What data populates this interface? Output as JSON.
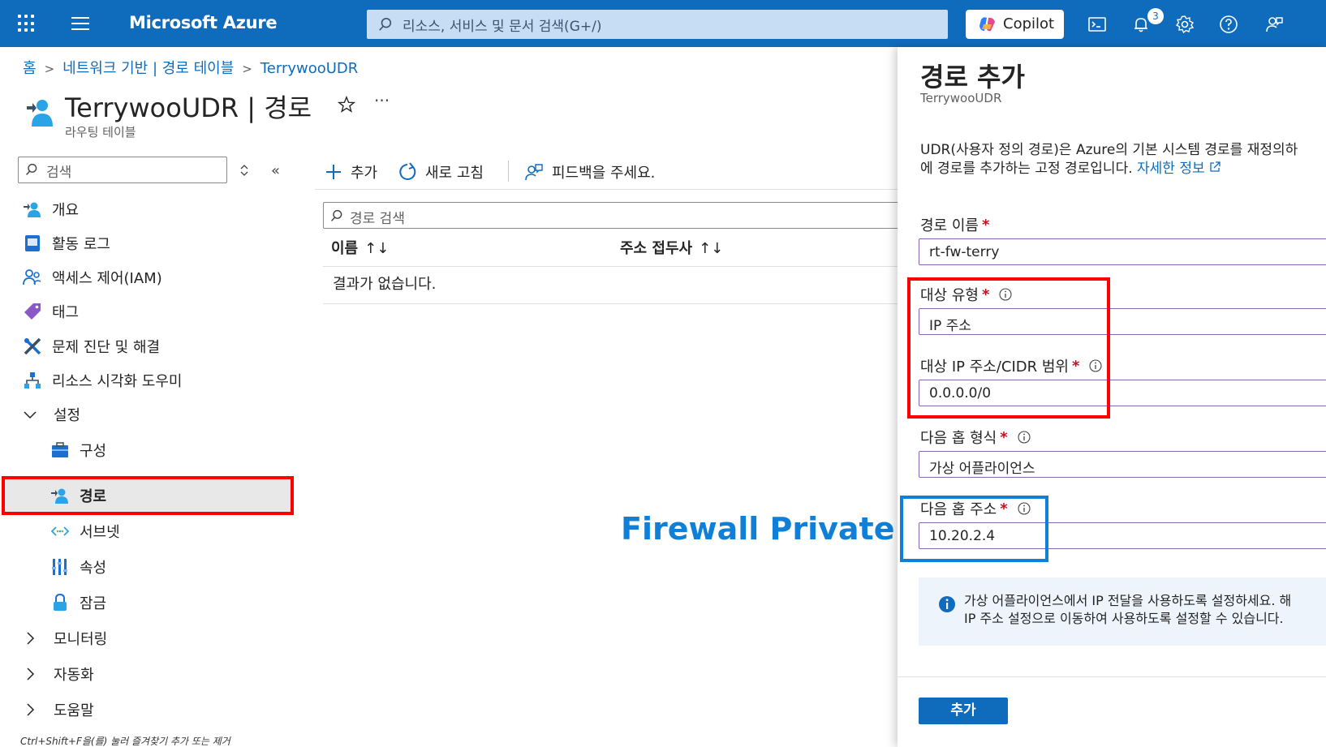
{
  "topbar": {
    "brand": "Microsoft Azure",
    "search_placeholder": "리소스, 서비스 및 문서 검색(G+/)",
    "copilot_label": "Copilot",
    "notification_count": "3"
  },
  "breadcrumb": {
    "items": [
      "홈",
      "네트워크 기반 | 경로 테이블",
      "TerrywooUDR"
    ]
  },
  "header": {
    "title": "TerrywooUDR | 경로",
    "subtitle": "라우팅 테이블",
    "more": "···"
  },
  "nav": {
    "search_placeholder": "검색",
    "collapse": "«",
    "items": [
      {
        "label": "개요",
        "icon": "overview-icon"
      },
      {
        "label": "활동 로그",
        "icon": "activity-log-icon"
      },
      {
        "label": "액세스 제어(IAM)",
        "icon": "iam-icon"
      },
      {
        "label": "태그",
        "icon": "tag-icon"
      },
      {
        "label": "문제 진단 및 해결",
        "icon": "diagnose-icon"
      },
      {
        "label": "리소스 시각화 도우미",
        "icon": "visualizer-icon"
      }
    ],
    "settings_group": "설정",
    "settings_items": [
      {
        "label": "구성",
        "icon": "configuration-icon"
      },
      {
        "label": "경로",
        "icon": "routes-icon"
      },
      {
        "label": "서브넷",
        "icon": "subnet-icon"
      },
      {
        "label": "속성",
        "icon": "properties-icon"
      },
      {
        "label": "잠금",
        "icon": "lock-icon"
      }
    ],
    "collapsed_groups": [
      "모니터링",
      "자동화",
      "도움말"
    ],
    "footer_hint": "Ctrl+Shift+F을(를) 눌러 즐겨찾기 추가 또는 제거"
  },
  "commands": {
    "add": "추가",
    "refresh": "새로 고침",
    "feedback": "피드백을 주세요."
  },
  "grid": {
    "search_placeholder": "경로 검색",
    "columns": [
      "이름",
      "주소 접두사"
    ],
    "sort_glyph": "↑↓",
    "empty_text": "결과가 없습니다."
  },
  "annotation": {
    "firewall_note": "Firewall Private IP"
  },
  "panel": {
    "title": "경로 추가",
    "subtitle": "TerrywooUDR",
    "description_line1": "UDR(사용자 정의 경로)은 Azure의 기본 시스템 경로를 재정의하",
    "description_line2": "에 경로를 추가하는 고정 경로입니다.",
    "learn_more": "자세한 정보",
    "fields": {
      "route_name_label": "경로 이름",
      "route_name_value": "rt-fw-terry",
      "dest_type_label": "대상 유형",
      "dest_type_value": "IP 주소",
      "dest_cidr_label": "대상 IP 주소/CIDR 범위",
      "dest_cidr_value": "0.0.0.0/0",
      "next_hop_type_label": "다음 홉 형식",
      "next_hop_type_value": "가상 어플라이언스",
      "next_hop_addr_label": "다음 홉 주소",
      "next_hop_addr_value": "10.20.2.4"
    },
    "required_mark": "*",
    "info_line1": "가상 어플라이언스에서 IP 전달을 사용하도록 설정하세요. 해",
    "info_line2": "IP 주소 설정으로 이동하여 사용하도록 설정할 수 있습니다.",
    "add_button": "추가"
  },
  "colors": {
    "azure_blue": "#0f6cbd",
    "highlight_red": "#ff0000",
    "highlight_blue": "#0f7fd8"
  }
}
